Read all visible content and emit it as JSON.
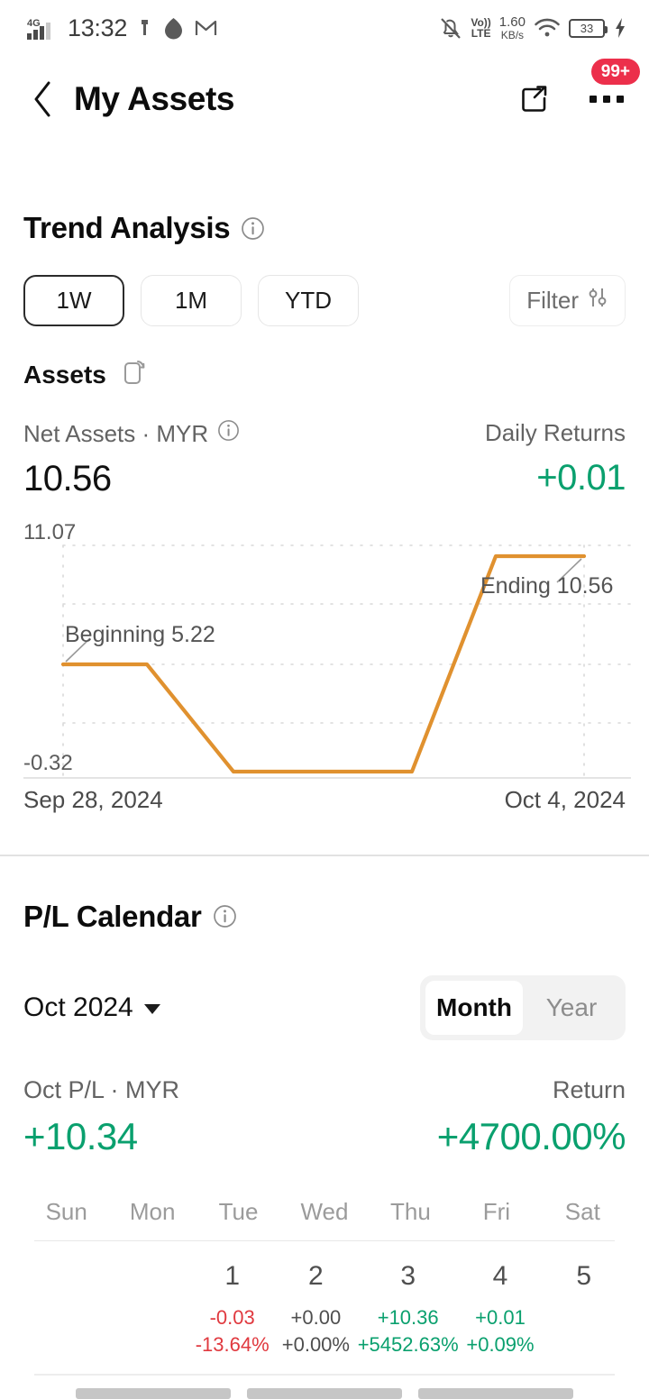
{
  "status_bar": {
    "network_type": "4G",
    "time": "13:32",
    "volte": "VoLTE",
    "volte_line1": "Vo))",
    "volte_line2": "LTE",
    "net_speed_value": "1.60",
    "net_speed_unit": "KB/s",
    "battery_level": "33",
    "icons": [
      "signal-4g-icon",
      "vibrate-icon",
      "teardrop-icon",
      "gmail-icon",
      "notifications-off-icon",
      "volte-icon",
      "wifi-icon",
      "battery-icon",
      "charging-bolt-icon"
    ]
  },
  "header": {
    "back_icon": "chevron-left-icon",
    "title": "My Assets",
    "share_icon": "share-icon",
    "more_icon": "more-horizontal-icon",
    "badge": "99+",
    "badge_color": "#ec2f4b"
  },
  "trend": {
    "section_title": "Trend Analysis",
    "info_icon": "info-icon",
    "tabs": [
      {
        "label": "1W",
        "selected": true
      },
      {
        "label": "1M",
        "selected": false
      },
      {
        "label": "YTD",
        "selected": false
      }
    ],
    "filter_label": "Filter",
    "filter_icon": "sliders-icon",
    "assets_label": "Assets",
    "rotate_icon": "rotate-screen-icon",
    "net_assets_label": "Net Assets · MYR",
    "net_assets_value": "10.56",
    "daily_returns_label": "Daily Returns",
    "daily_returns_value": "+0.01",
    "positive_color": "#0aa06e"
  },
  "chart_data": {
    "type": "line",
    "title": "Net Assets · MYR",
    "line_color": "#e0912f",
    "grid": true,
    "legend": "none",
    "ylabel": "",
    "xlabel": "",
    "ylim": [
      -0.32,
      11.07
    ],
    "y_ticks": [
      "11.07",
      "-0.32"
    ],
    "x_ticks": [
      "Sep 28, 2024",
      "Oct 4, 2024"
    ],
    "x": [
      "Sep 28, 2024",
      "Sep 29, 2024",
      "Sep 30, 2024",
      "Oct 1, 2024",
      "Oct 2, 2024",
      "Oct 3, 2024",
      "Oct 4, 2024"
    ],
    "values": [
      5.22,
      5.22,
      0.19,
      0.19,
      0.19,
      10.55,
      10.56
    ],
    "annotations": [
      {
        "label": "Beginning 5.22",
        "x": "Sep 28, 2024",
        "value": 5.22
      },
      {
        "label": "Ending 10.56",
        "x": "Oct 4, 2024",
        "value": 10.56
      }
    ]
  },
  "pl_calendar": {
    "section_title": "P/L Calendar",
    "info_icon": "info-icon",
    "month_selector": "Oct 2024",
    "caret_icon": "chevron-down-icon",
    "range_tabs": [
      {
        "label": "Month",
        "selected": true
      },
      {
        "label": "Year",
        "selected": false
      }
    ],
    "pl_label": "Oct P/L · MYR",
    "pl_value": "+10.34",
    "return_label": "Return",
    "return_value": "+4700.00%",
    "day_headers": [
      "Sun",
      "Mon",
      "Tue",
      "Wed",
      "Thu",
      "Fri",
      "Sat"
    ],
    "weeks": [
      [
        {
          "day": "",
          "pl": "",
          "pct": "",
          "sign": ""
        },
        {
          "day": "",
          "pl": "",
          "pct": "",
          "sign": ""
        },
        {
          "day": "1",
          "pl": "-0.03",
          "pct": "-13.64%",
          "sign": "neg"
        },
        {
          "day": "2",
          "pl": "+0.00",
          "pct": "+0.00%",
          "sign": "zero"
        },
        {
          "day": "3",
          "pl": "+10.36",
          "pct": "+5452.63%",
          "sign": "pos"
        },
        {
          "day": "4",
          "pl": "+0.01",
          "pct": "+0.09%",
          "sign": "pos"
        },
        {
          "day": "5",
          "pl": "",
          "pct": "",
          "sign": ""
        }
      ]
    ],
    "positive_color": "#0aa06e",
    "negative_color": "#e0393f"
  }
}
